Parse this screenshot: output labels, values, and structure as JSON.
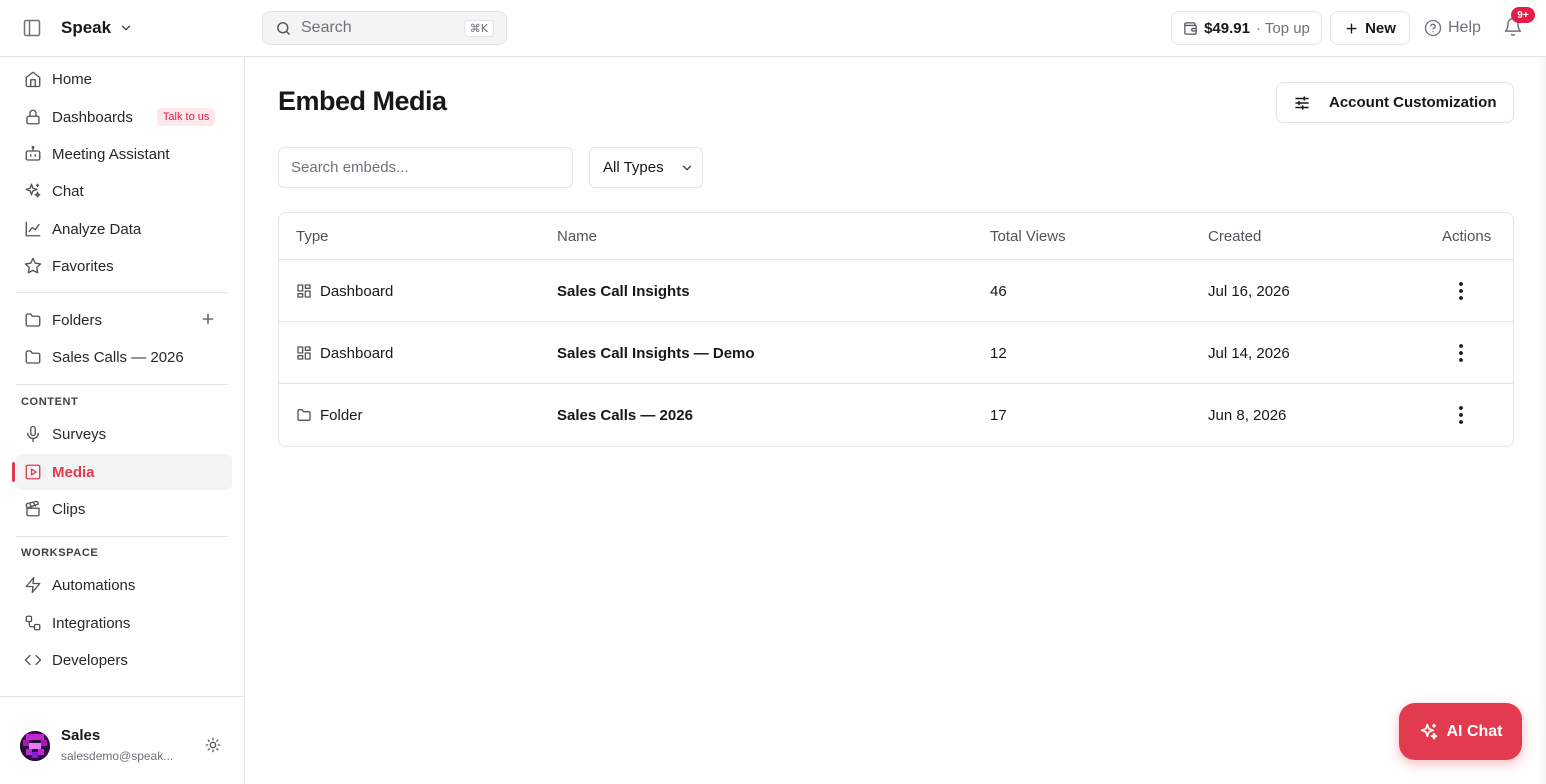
{
  "topbar": {
    "workspace_name": "Speak",
    "search_placeholder": "Search",
    "search_shortcut": "⌘K",
    "credit_amount": "$49.91",
    "credit_action": "· Top up",
    "new_label": "New",
    "help_label": "Help",
    "notifications_badge": "9+"
  },
  "sidebar": {
    "nav": [
      {
        "label": "Home",
        "icon": "home-icon"
      },
      {
        "label": "Dashboards",
        "icon": "lock-icon",
        "badge": "Talk to us"
      },
      {
        "label": "Meeting Assistant",
        "icon": "bot-icon"
      },
      {
        "label": "Chat",
        "icon": "sparkles-icon"
      },
      {
        "label": "Analyze Data",
        "icon": "chart-line-icon"
      },
      {
        "label": "Favorites",
        "icon": "star-icon"
      }
    ],
    "folders": [
      {
        "label": "Folders",
        "icon": "folder-icon"
      },
      {
        "label": "Sales Calls — 2026",
        "icon": "folder-icon"
      }
    ],
    "content_heading": "CONTENT",
    "content": [
      {
        "label": "Surveys",
        "icon": "microphone-icon"
      },
      {
        "label": "Media",
        "icon": "video-icon",
        "active": true
      },
      {
        "label": "Clips",
        "icon": "clapperboard-icon"
      }
    ],
    "workspace_heading": "WORKSPACE",
    "workspace": [
      {
        "label": "Automations",
        "icon": "zap-icon"
      },
      {
        "label": "Integrations",
        "icon": "workflow-icon"
      },
      {
        "label": "Developers",
        "icon": "code-icon"
      }
    ],
    "user": {
      "name": "Sales",
      "email": "salesdemo@speak..."
    }
  },
  "main": {
    "title": "Embed Media",
    "account_button": "Account Customization",
    "search_placeholder": "Search embeds...",
    "type_filter": "All Types",
    "table": {
      "headers": [
        "Type",
        "Name",
        "Total Views",
        "Created",
        "Actions"
      ],
      "rows": [
        {
          "type": "Dashboard",
          "type_icon": "dashboard-icon",
          "name": "Sales Call Insights",
          "views": "46",
          "created": "Jul 16, 2026"
        },
        {
          "type": "Dashboard",
          "type_icon": "dashboard-icon",
          "name": "Sales Call Insights — Demo",
          "views": "12",
          "created": "Jul 14, 2026"
        },
        {
          "type": "Folder",
          "type_icon": "folder-icon",
          "name": "Sales Calls — 2026",
          "views": "17",
          "created": "Jun 8, 2026"
        }
      ]
    },
    "ai_chat_label": "AI Chat"
  },
  "colors": {
    "accent": "#e23a4e",
    "border": "#e4e4e7",
    "muted_text": "#71717a"
  }
}
